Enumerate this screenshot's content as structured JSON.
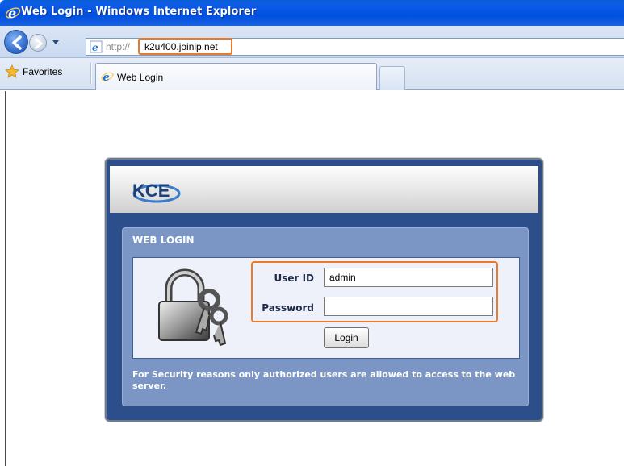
{
  "window": {
    "title": "Web Login - Windows Internet Explorer"
  },
  "nav": {
    "address_prefix": "http://",
    "address_host": "k2u400.joinip.net",
    "back_icon": "back-arrow-icon",
    "forward_icon": "forward-arrow-icon",
    "dropdown_icon": "chevron-down-icon"
  },
  "tabs": {
    "favorites_label": "Favorites",
    "active_tab_label": "Web Login"
  },
  "login": {
    "logo_text": "KCE",
    "panel_title": "WEB LOGIN",
    "user_label": "User ID",
    "user_value": "admin",
    "password_label": "Password",
    "password_value": "",
    "button_label": "Login",
    "security_note": "For Security reasons only authorized users are allowed to access to the web server."
  },
  "colors": {
    "titlebar": "#0050e0",
    "highlight": "#e97a2a",
    "frame_blue": "#2c4f8c",
    "panel_blue": "#7b96c4"
  }
}
